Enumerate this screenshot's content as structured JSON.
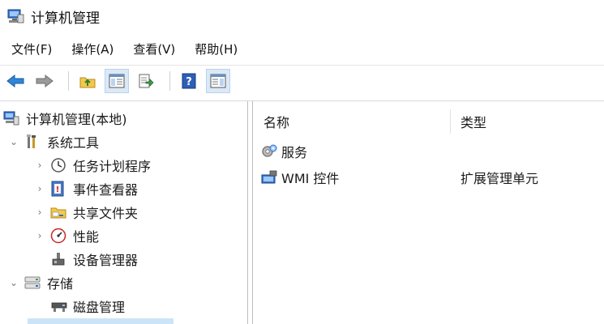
{
  "window": {
    "title": "计算机管理"
  },
  "menu": {
    "items": [
      {
        "label": "文件(F)"
      },
      {
        "label": "操作(A)"
      },
      {
        "label": "查看(V)"
      },
      {
        "label": "帮助(H)"
      }
    ]
  },
  "toolbar": {
    "buttons": [
      {
        "icon": "back-arrow-icon"
      },
      {
        "icon": "forward-arrow-icon"
      },
      {
        "icon": "up-folder-icon"
      },
      {
        "icon": "show-hide-tree-icon"
      },
      {
        "icon": "export-list-icon"
      },
      {
        "icon": "help-icon"
      },
      {
        "icon": "action-pane-icon"
      }
    ]
  },
  "tree": {
    "root": {
      "label": "计算机管理(本地)"
    },
    "system_tools": {
      "label": "系统工具"
    },
    "task_scheduler": {
      "label": "任务计划程序"
    },
    "event_viewer": {
      "label": "事件查看器"
    },
    "shared_folders": {
      "label": "共享文件夹"
    },
    "performance": {
      "label": "性能"
    },
    "device_manager": {
      "label": "设备管理器"
    },
    "storage": {
      "label": "存储"
    },
    "disk_management": {
      "label": "磁盘管理"
    }
  },
  "list": {
    "headers": {
      "name": "名称",
      "type": "类型"
    },
    "rows": [
      {
        "name": "服务",
        "type": ""
      },
      {
        "name": "WMI 控件",
        "type": "扩展管理单元"
      }
    ]
  },
  "colors": {
    "accent": "#2f6fc9",
    "selection": "#cce4f7",
    "active_button": "#dbe9f7"
  }
}
